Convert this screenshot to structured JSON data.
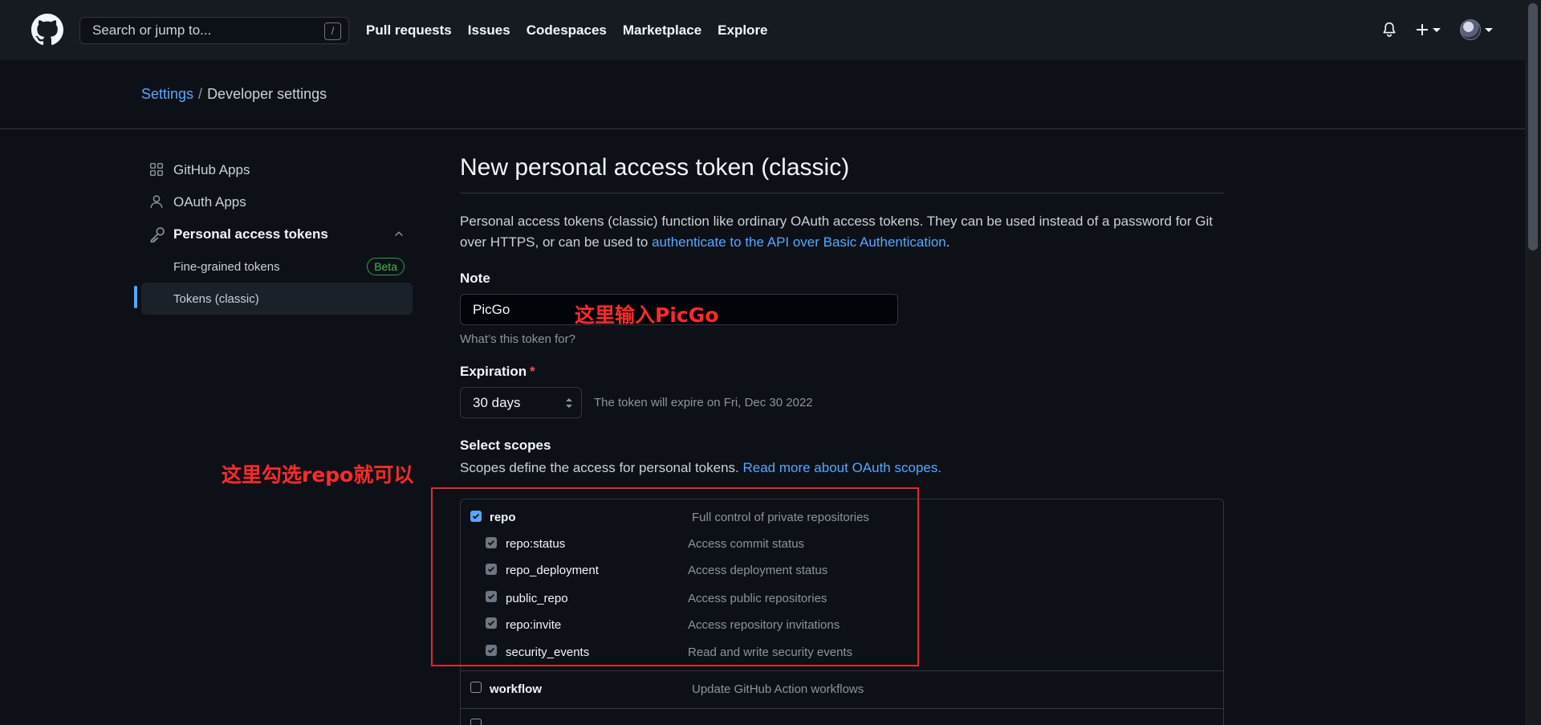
{
  "header": {
    "search_placeholder": "Search or jump to...",
    "search_shortcut": "/",
    "nav": [
      "Pull requests",
      "Issues",
      "Codespaces",
      "Marketplace",
      "Explore"
    ]
  },
  "breadcrumb": {
    "parent": "Settings",
    "separator": "/",
    "current": "Developer settings"
  },
  "sidebar": {
    "items": [
      {
        "label": "GitHub Apps",
        "icon": "apps-grid-icon"
      },
      {
        "label": "OAuth Apps",
        "icon": "person-icon"
      },
      {
        "label": "Personal access tokens",
        "icon": "key-icon"
      }
    ],
    "sub_items": [
      {
        "label": "Fine-grained tokens",
        "badge": "Beta"
      },
      {
        "label": "Tokens (classic)"
      }
    ]
  },
  "main": {
    "title": "New personal access token (classic)",
    "intro_text": "Personal access tokens (classic) function like ordinary OAuth access tokens. They can be used instead of a password for Git over HTTPS, or can be used to ",
    "intro_link": "authenticate to the API over Basic Authentication",
    "intro_end": ".",
    "note_label": "Note",
    "note_value": "PicGo",
    "note_hint": "What’s this token for?",
    "expiration_label": "Expiration",
    "expiration_required": "*",
    "expiration_value": "30 days",
    "expiration_note": "The token will expire on Fri, Dec 30 2022",
    "scopes_label": "Select scopes",
    "scopes_desc": "Scopes define the access for personal tokens. ",
    "scopes_link": "Read more about OAuth scopes."
  },
  "scopes": [
    {
      "name": "repo",
      "desc": "Full control of private repositories",
      "checked": true,
      "top": true
    },
    {
      "name": "repo:status",
      "desc": "Access commit status",
      "checked": true,
      "top": false
    },
    {
      "name": "repo_deployment",
      "desc": "Access deployment status",
      "checked": true,
      "top": false
    },
    {
      "name": "public_repo",
      "desc": "Access public repositories",
      "checked": true,
      "top": false
    },
    {
      "name": "repo:invite",
      "desc": "Access repository invitations",
      "checked": true,
      "top": false
    },
    {
      "name": "security_events",
      "desc": "Read and write security events",
      "checked": true,
      "top": false
    },
    {
      "name": "workflow",
      "desc": "Update GitHub Action workflows",
      "checked": false,
      "top": true
    }
  ],
  "annotations": {
    "note_annotation": "这里输入PicGo",
    "scope_annotation": "这里勾选repo就可以"
  },
  "colors": {
    "accent": "#58a6ff",
    "annotation": "#ff2a2a",
    "badge": "#3fb950"
  }
}
